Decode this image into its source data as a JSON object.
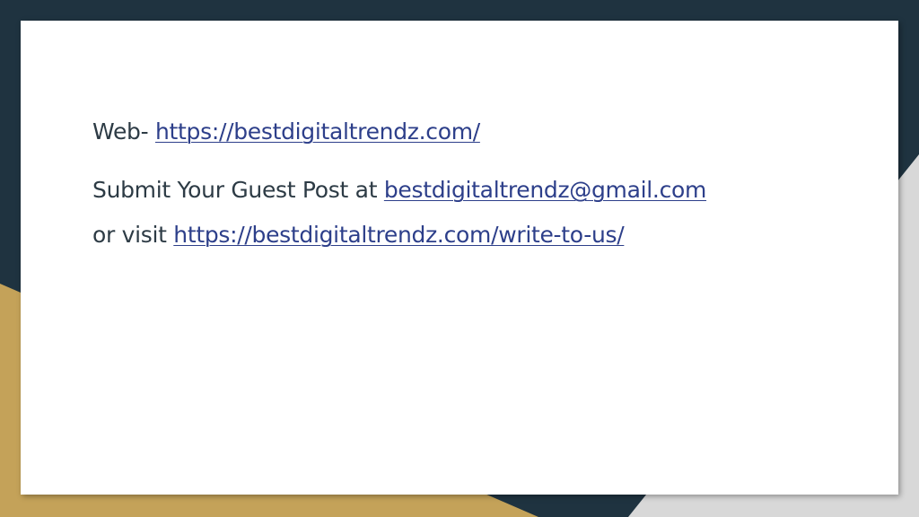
{
  "slide": {
    "web_label": "Web-",
    "web_url": "https://bestdigitaltrendz.com/",
    "submit_prefix": "Submit Your Guest Post at",
    "email": "bestdigitaltrendz@gmail.com",
    "visit_prefix": "or visit",
    "write_url": "https://bestdigitaltrendz.com/write-to-us/"
  },
  "colors": {
    "background_dark": "#1f3340",
    "accent_gold": "#c4a259",
    "accent_light_gray": "#d8d8d8",
    "card": "#ffffff",
    "text": "#2d3b45",
    "link": "#2d3f8a"
  }
}
